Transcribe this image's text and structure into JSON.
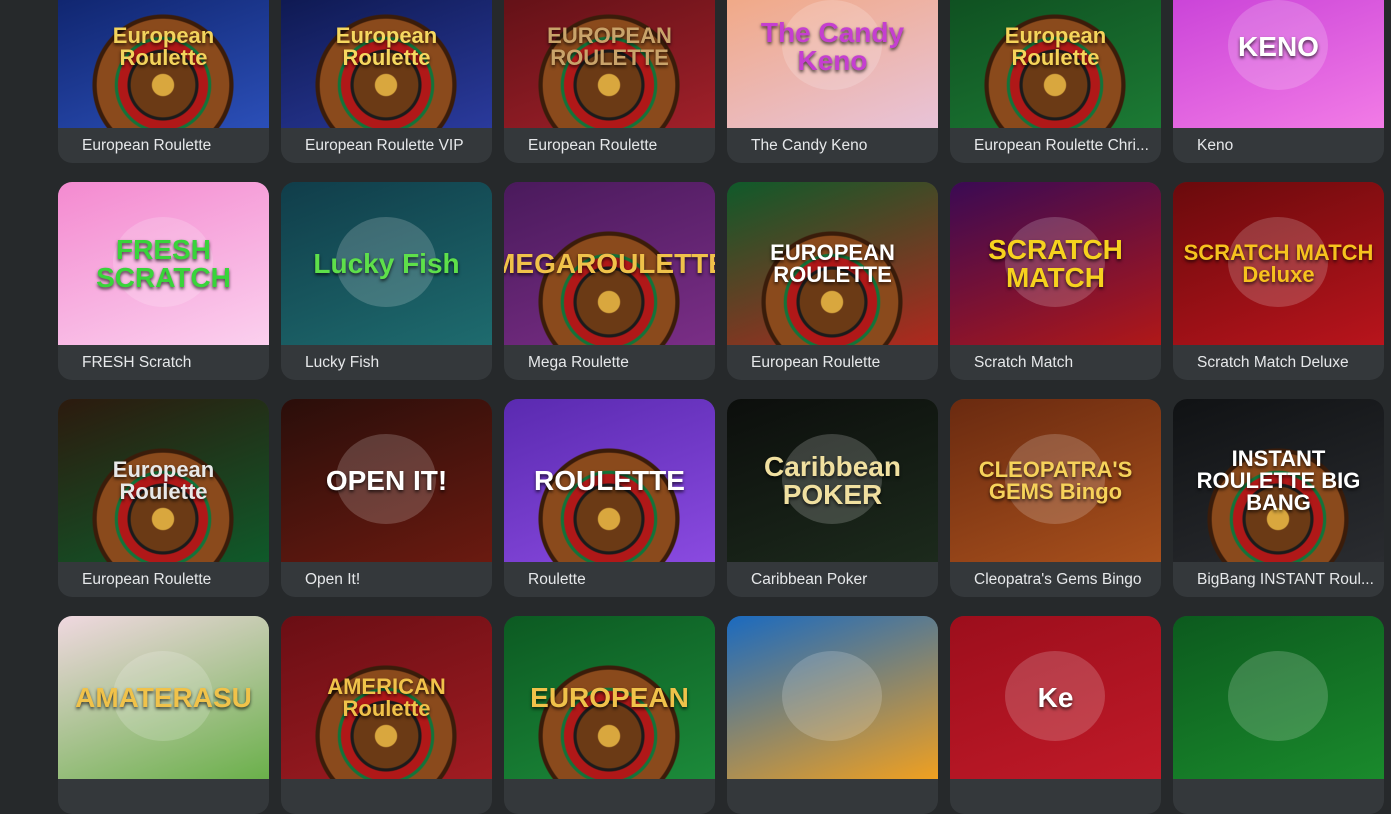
{
  "games": [
    {
      "label": "European Roulette",
      "art": "European Roulette",
      "colors": [
        "#0c1f64",
        "#2b4fb8"
      ],
      "text_color": "#f2d35c",
      "icon": "roulette-wheel-icon"
    },
    {
      "label": "European Roulette VIP",
      "art": "European Roulette",
      "colors": [
        "#0a1446",
        "#2a3a9c"
      ],
      "text_color": "#f6d860",
      "icon": "roulette-wheel-icon"
    },
    {
      "label": "European Roulette",
      "art": "EUROPEAN ROULETTE",
      "colors": [
        "#5a0f14",
        "#a0202a"
      ],
      "text_color": "#c9a36a",
      "icon": "roulette-wheel-icon"
    },
    {
      "label": "The Candy Keno",
      "art": "The Candy Keno",
      "colors": [
        "#f2a57a",
        "#e8c3d8"
      ],
      "text_color": "#c53fd0",
      "icon": "candy-icon"
    },
    {
      "label": "European Roulette Chri...",
      "art": "European Roulette",
      "colors": [
        "#0d4a1e",
        "#1c7a34"
      ],
      "text_color": "#f5d45a",
      "icon": "roulette-wheel-icon"
    },
    {
      "label": "Keno",
      "art": "KENO",
      "colors": [
        "#c43bd6",
        "#f27be6"
      ],
      "text_color": "#ffffff",
      "icon": "dice-icon"
    },
    {
      "label": "FRESH Scratch",
      "art": "FRESH SCRATCH",
      "colors": [
        "#f48ad0",
        "#fbd0ee"
      ],
      "text_color": "#38d43a",
      "icon": "cat-icon"
    },
    {
      "label": "Lucky Fish",
      "art": "Lucky Fish",
      "colors": [
        "#103d4a",
        "#1e6b6e"
      ],
      "text_color": "#5ee04a",
      "icon": "octopus-icon"
    },
    {
      "label": "Mega Roulette",
      "art": "MEGAROULETTE",
      "colors": [
        "#4a1a5c",
        "#7a2e86"
      ],
      "text_color": "#f0c24a",
      "icon": "roulette-wheel-icon"
    },
    {
      "label": "European Roulette",
      "art": "EUROPEAN ROULETTE",
      "colors": [
        "#0f5a2a",
        "#b0281e"
      ],
      "text_color": "#ffffff",
      "icon": "roulette-wheel-icon"
    },
    {
      "label": "Scratch Match",
      "art": "SCRATCH MATCH",
      "colors": [
        "#3a0a54",
        "#b01818"
      ],
      "text_color": "#f6d21e",
      "icon": "money-bag-icon"
    },
    {
      "label": "Scratch Match Deluxe",
      "art": "SCRATCH MATCH Deluxe",
      "colors": [
        "#6a0a0c",
        "#b8141c"
      ],
      "text_color": "#f6c21e",
      "icon": "scratch-card-icon"
    },
    {
      "label": "European Roulette",
      "art": "European Roulette",
      "colors": [
        "#2c1a0e",
        "#0f5a2a"
      ],
      "text_color": "#e8e8e8",
      "icon": "roulette-wheel-icon"
    },
    {
      "label": "Open It!",
      "art": "OPEN IT!",
      "colors": [
        "#2a0e0a",
        "#6a1a10"
      ],
      "text_color": "#ffffff",
      "icon": "gift-icon"
    },
    {
      "label": "Roulette",
      "art": "ROULETTE",
      "colors": [
        "#5a2ab0",
        "#8a4ae0"
      ],
      "text_color": "#ffffff",
      "icon": "roulette-wheel-icon"
    },
    {
      "label": "Caribbean Poker",
      "art": "Caribbean POKER",
      "colors": [
        "#0c0e0c",
        "#1c2a1c"
      ],
      "text_color": "#f0e0a0",
      "icon": "cards-icon"
    },
    {
      "label": "Cleopatra's Gems Bingo",
      "art": "CLEOPATRA'S GEMS Bingo",
      "colors": [
        "#6a2a10",
        "#a8501c"
      ],
      "text_color": "#f6d25a",
      "icon": "cat-icon"
    },
    {
      "label": "BigBang INSTANT Roul...",
      "art": "INSTANT ROULETTE BIG BANG",
      "colors": [
        "#101214",
        "#2a2c30"
      ],
      "text_color": "#ffffff",
      "icon": "roulette-wheel-icon"
    },
    {
      "label": "",
      "art": "AMATERASU",
      "colors": [
        "#f0d8e0",
        "#6ab04a"
      ],
      "text_color": "#f0c24a",
      "icon": "blossom-icon"
    },
    {
      "label": "",
      "art": "AMERICAN Roulette",
      "colors": [
        "#6a0e14",
        "#a01c22"
      ],
      "text_color": "#f0c24a",
      "icon": "roulette-wheel-icon"
    },
    {
      "label": "",
      "art": "EUROPEAN",
      "colors": [
        "#0c5a22",
        "#1c8a3a"
      ],
      "text_color": "#f0c24a",
      "icon": "roulette-wheel-icon"
    },
    {
      "label": "",
      "art": "",
      "colors": [
        "#1a6ac0",
        "#f0a020"
      ],
      "text_color": "#ffffff",
      "icon": "dragon-icon"
    },
    {
      "label": "",
      "art": "Ke",
      "colors": [
        "#9c0e1c",
        "#c01a28"
      ],
      "text_color": "#ffffff",
      "icon": "keno-balls-icon"
    },
    {
      "label": "",
      "art": "",
      "colors": [
        "#0c5a1e",
        "#1a8a2c"
      ],
      "text_color": "#f0c24a",
      "icon": "palm-tree-icon"
    }
  ]
}
